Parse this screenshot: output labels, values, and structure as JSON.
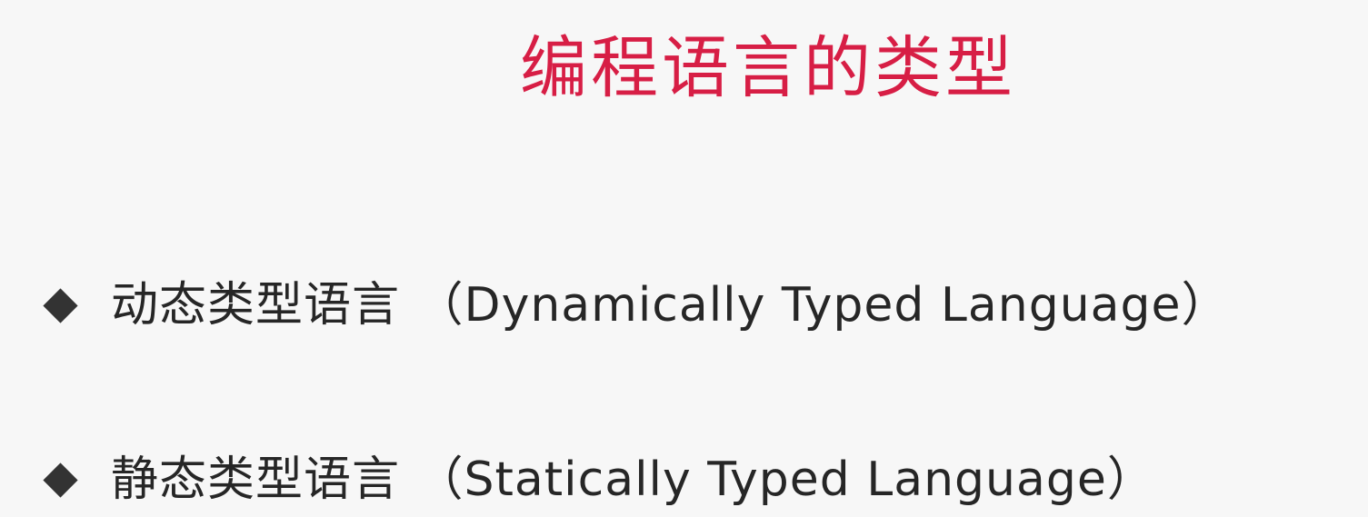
{
  "slide": {
    "title": "编程语言的类型",
    "bullets": [
      {
        "text": "动态类型语言 （Dynamically Typed Language）"
      },
      {
        "text": "静态类型语言 （Statically Typed Language）"
      }
    ]
  },
  "colors": {
    "title": "#d71e45",
    "text": "#262626",
    "bullet_marker": "#333333",
    "background": "#f7f7f7"
  }
}
